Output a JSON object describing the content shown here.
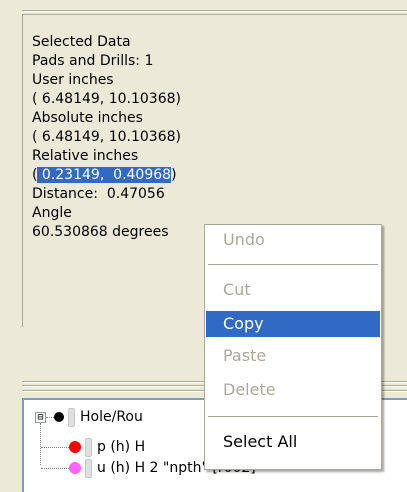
{
  "info": {
    "lines": [
      "Selected Data",
      "Pads and Drills: 1",
      "User inches",
      "( 6.48149, 10.10368)",
      "Absolute inches",
      "( 6.48149, 10.10368)",
      "Relative inches"
    ],
    "relative_prefix": "(",
    "relative_selected": " 0.23149,  0.40968",
    "relative_suffix": ")",
    "distance": "Distance:  0.47056",
    "angle_label": "Angle",
    "angle_value": "60.530868 degrees"
  },
  "tree": {
    "root_expander": "⊟",
    "root_label": "Hole/Rou",
    "child1_label": "p (h) H",
    "child1_color": "#ff0000",
    "child2_label": "u (h) H 2 \"npth\" [r002]",
    "child2_color": "#ff66ff"
  },
  "context_menu": {
    "items": [
      {
        "label": "Undo",
        "enabled": false
      },
      {
        "label": "Cut",
        "enabled": false
      },
      {
        "label": "Copy",
        "enabled": true,
        "highlighted": true
      },
      {
        "label": "Paste",
        "enabled": false
      },
      {
        "label": "Delete",
        "enabled": false
      },
      {
        "label": "Select All",
        "enabled": true
      }
    ]
  },
  "colors": {
    "highlight": "#316ac5",
    "disabled_text": "#aca899",
    "panel_bg": "#ece9d8"
  }
}
